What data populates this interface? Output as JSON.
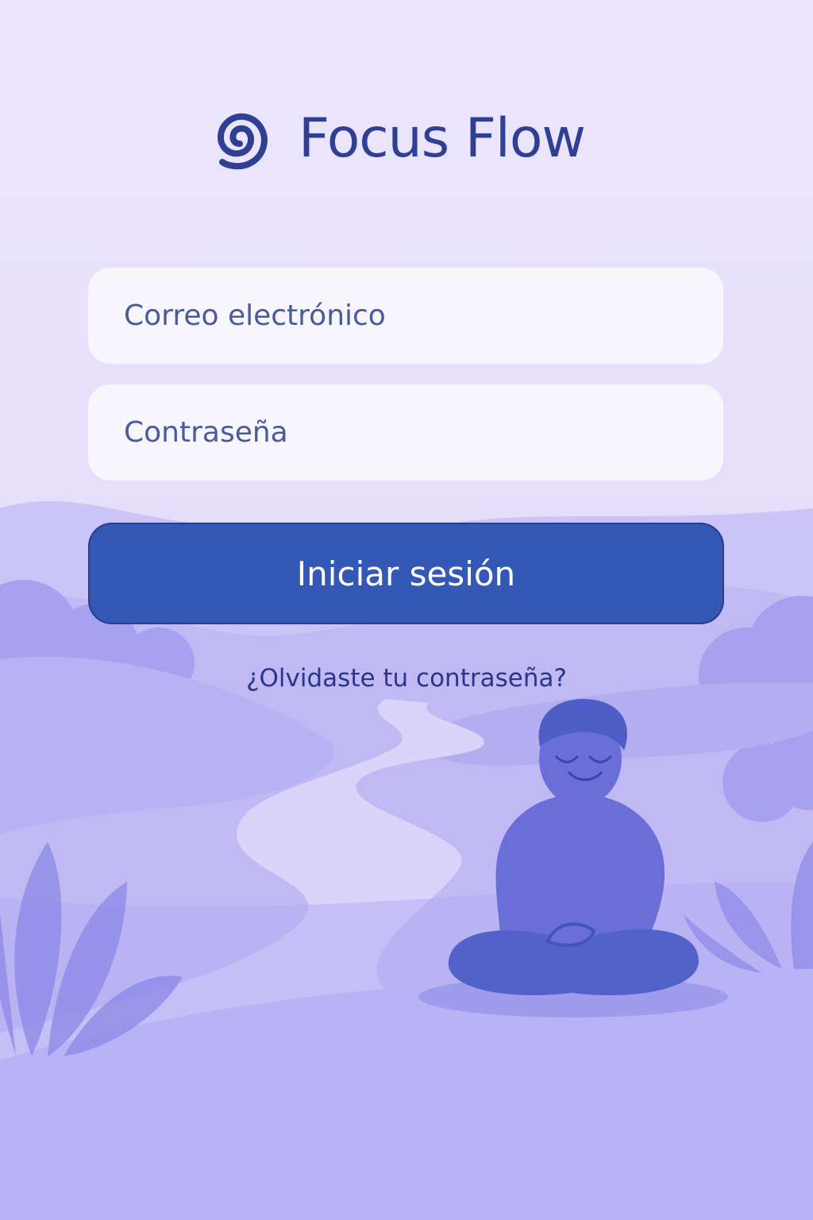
{
  "app": {
    "name": "Focus Flow",
    "logo_icon": "spiral-logo-icon"
  },
  "login_form": {
    "email_placeholder": "Correo electrónico",
    "password_placeholder": "Contraseña",
    "submit_label": "Iniciar sesión",
    "forgot_password_label": "¿Olvidaste tu contraseña?"
  },
  "theme": {
    "background": "#e9e4fb",
    "brand_text": "#2f3f93",
    "button": "#3359b5",
    "button_text": "#ffffff",
    "illustration": "#6d6fd9"
  },
  "illustration": {
    "subject": "meditating-person-on-hills"
  }
}
